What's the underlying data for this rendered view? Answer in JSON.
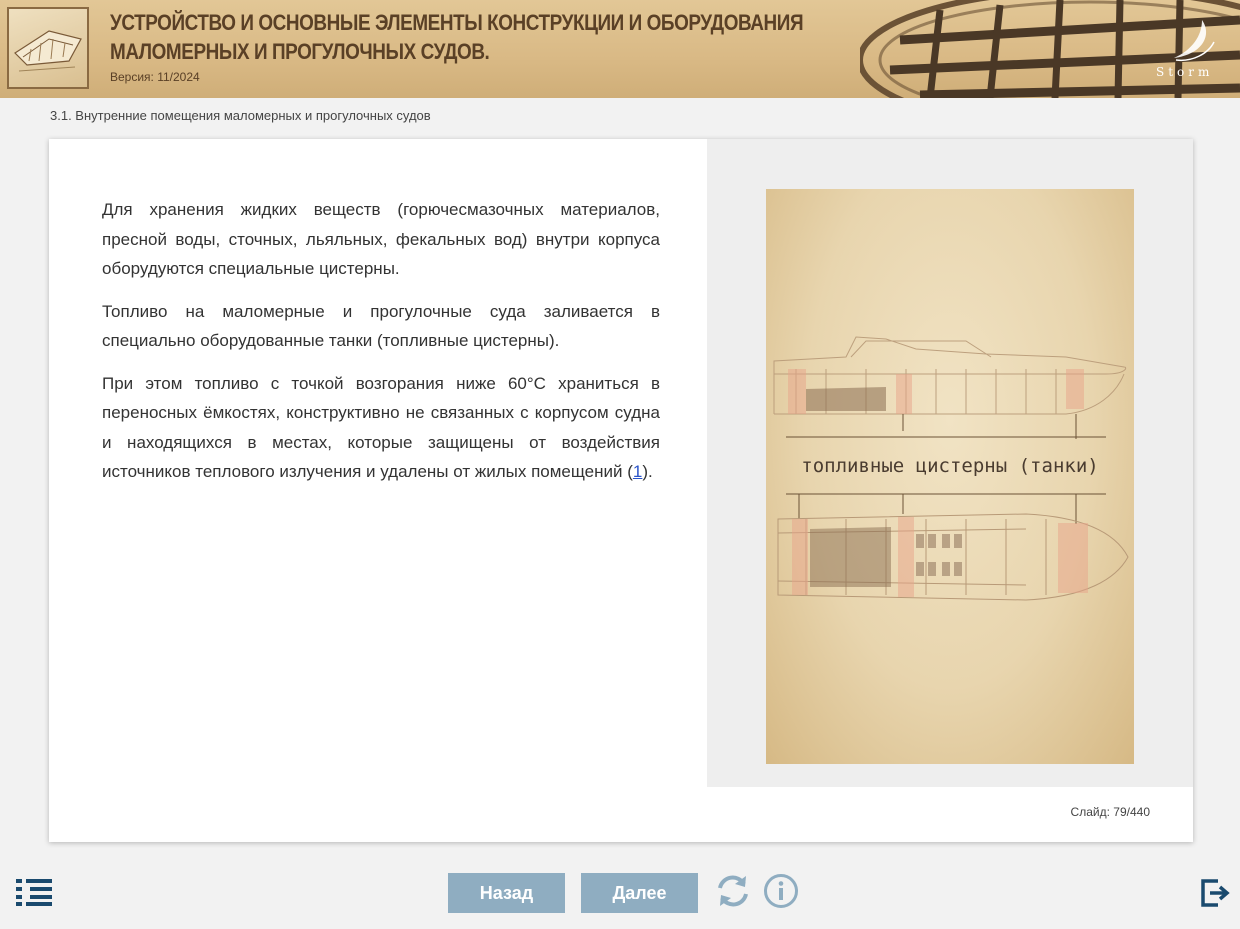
{
  "header": {
    "title_line1": "УСТРОЙСТВО И ОСНОВНЫЕ ЭЛЕМЕНТЫ КОНСТРУКЦИИ И ОБОРУДОВАНИЯ",
    "title_line2": "МАЛОМЕРНЫХ И ПРОГУЛОЧНЫХ СУДОВ.",
    "version": "Версия: 11/2024",
    "logo_text": "Storm"
  },
  "breadcrumb": "3.1. Внутренние помещения маломерных и прогулочных судов",
  "content": {
    "p1": "Для хранения жидких веществ (горючесмазочных материалов, пресной воды, сточных, льяльных, фекальных вод) внутри корпуса оборудуются специальные цистерны.",
    "p2": "Топливо на маломерные и прогулочные суда заливается в специально оборудованные танки (топливные цистерны).",
    "p3_before": "При этом топливо с точкой возгорания ниже 60°С храниться в переносных ёмкостях, конструктивно не связанных с корпусом судна и находящихся в местах, которые защищены от воздействия источников теплового излучения и удалены от жилых помещений (",
    "p3_link": "1",
    "p3_after": ")."
  },
  "illustration": {
    "caption": "топливные цистерны (танки)"
  },
  "slide": {
    "label": "Слайд:",
    "current": "79",
    "separator": "/",
    "total": "440"
  },
  "footer": {
    "back_label": "Назад",
    "next_label": "Далее"
  },
  "colors": {
    "header_bg": "#d9b985",
    "header_text": "#5a4026",
    "nav_button": "#8fadc1",
    "icon_blue": "#1a4a6e",
    "link": "#2a54c9"
  }
}
